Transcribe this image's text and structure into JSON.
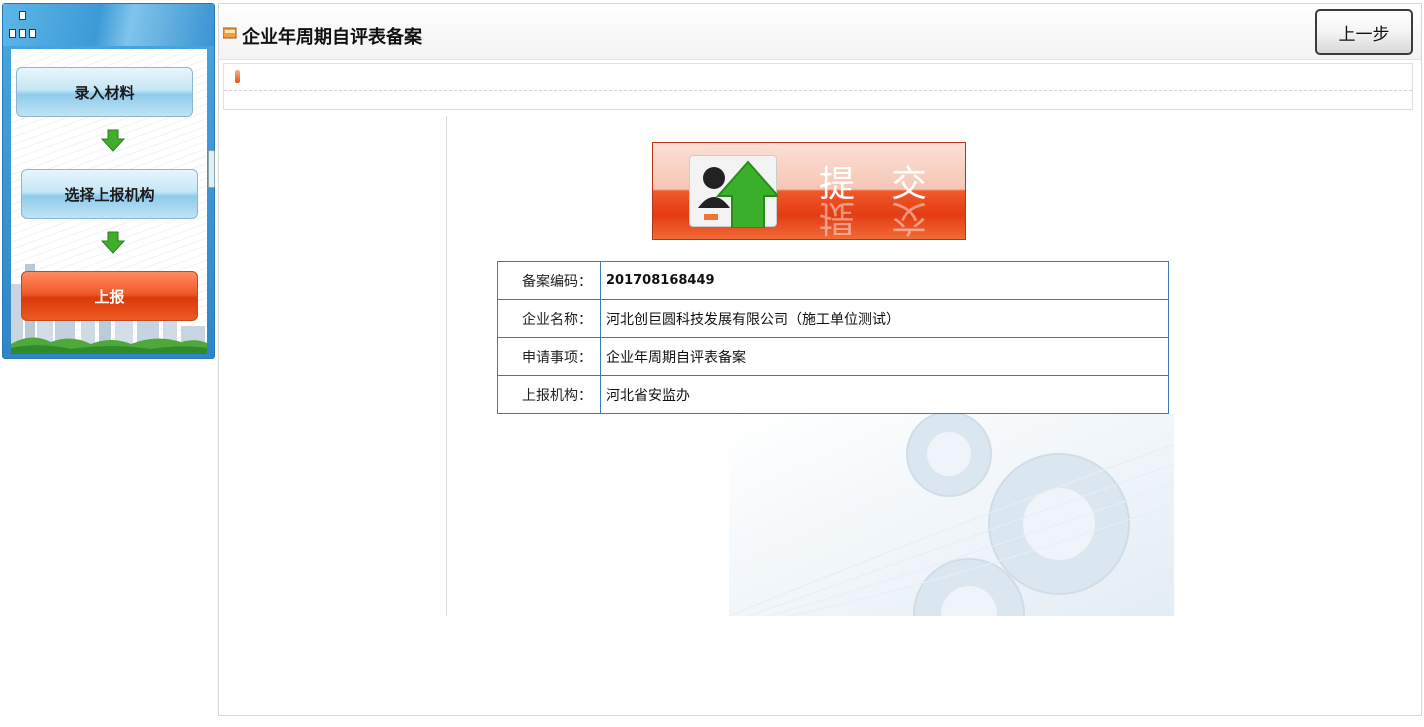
{
  "sidebar": {
    "steps": [
      {
        "label": "录入材料",
        "state": "done"
      },
      {
        "label": "选择上报机构",
        "state": "done"
      },
      {
        "label": "上报",
        "state": "active"
      }
    ]
  },
  "header": {
    "title": "企业年周期自评表备案",
    "back_label": "上一步"
  },
  "submit": {
    "label_1": "提",
    "label_2": "交"
  },
  "details": [
    {
      "key": "备案编码：",
      "value": "201708168449"
    },
    {
      "key": "企业名称：",
      "value": "河北创巨圆科技发展有限公司（施工单位测试）"
    },
    {
      "key": "申请事项：",
      "value": "企业年周期自评表备案"
    },
    {
      "key": "上报机构：",
      "value": "河北省安监办"
    }
  ],
  "colors": {
    "accent_blue": "#3a93d1",
    "active_step": "#e8461a",
    "table_border": "#3b7ab7"
  }
}
